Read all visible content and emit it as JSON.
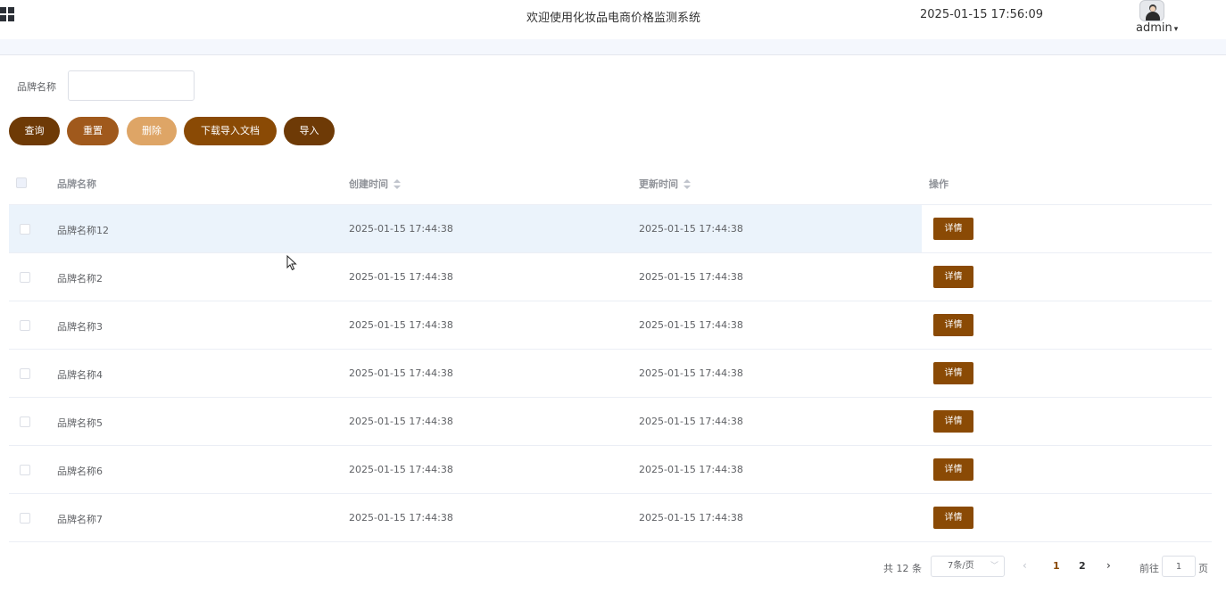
{
  "header": {
    "title": "欢迎使用化妆品电商价格监测系统",
    "datetime": "2025-01-15 17:56:09",
    "user": "admin"
  },
  "search": {
    "label": "品牌名称",
    "value": "",
    "placeholder": ""
  },
  "toolbar": {
    "query_label": "查询",
    "reset_label": "重置",
    "delete_label": "删除",
    "download_label": "下载导入文档",
    "import_label": "导入"
  },
  "table": {
    "columns": [
      "品牌名称",
      "创建时间",
      "更新时间",
      "操作"
    ],
    "rows": [
      {
        "name": "品牌名称12",
        "created": "2025-01-15 17:44:38",
        "updated": "2025-01-15 17:44:38",
        "action": "详情"
      },
      {
        "name": "品牌名称2",
        "created": "2025-01-15 17:44:38",
        "updated": "2025-01-15 17:44:38",
        "action": "详情"
      },
      {
        "name": "品牌名称3",
        "created": "2025-01-15 17:44:38",
        "updated": "2025-01-15 17:44:38",
        "action": "详情"
      },
      {
        "name": "品牌名称4",
        "created": "2025-01-15 17:44:38",
        "updated": "2025-01-15 17:44:38",
        "action": "详情"
      },
      {
        "name": "品牌名称5",
        "created": "2025-01-15 17:44:38",
        "updated": "2025-01-15 17:44:38",
        "action": "详情"
      },
      {
        "name": "品牌名称6",
        "created": "2025-01-15 17:44:38",
        "updated": "2025-01-15 17:44:38",
        "action": "详情"
      },
      {
        "name": "品牌名称7",
        "created": "2025-01-15 17:44:38",
        "updated": "2025-01-15 17:44:38",
        "action": "详情"
      }
    ]
  },
  "pagination": {
    "total": "共 12 条",
    "page_size": "7条/页",
    "pages": [
      "1",
      "2"
    ],
    "current": "1",
    "goto_prefix": "前往",
    "goto_value": "1",
    "goto_suffix": "页"
  },
  "colors": {
    "accent": "#8a4a05",
    "hover_row": "#ebf3fb"
  }
}
